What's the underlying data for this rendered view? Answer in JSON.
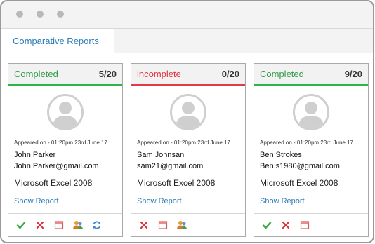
{
  "window": {
    "tab_label": "Comparative Reports"
  },
  "cards": [
    {
      "status": "Completed",
      "count": "5/20",
      "appeared": "Appeared on - 01:20pm 23rd June 17",
      "name": "John Parker",
      "email": "John.Parker@gmail.com",
      "course": "Microsoft Excel 2008",
      "link": "Show Report",
      "actions": [
        "check-icon",
        "cross-icon",
        "window-icon",
        "users-icon",
        "refresh-icon"
      ]
    },
    {
      "status": "incomplete",
      "count": "0/20",
      "appeared": "Appeared on - 01:20pm 23rd June 17",
      "name": "Sam Johnsan",
      "email": "sam21@gmail.com",
      "course": "Microsoft Excel 2008",
      "link": "Show Report",
      "actions": [
        "cross-icon",
        "window-icon",
        "users-icon"
      ]
    },
    {
      "status": "Completed",
      "count": "9/20",
      "appeared": "Appeared on - 01:20pm 23rd June 17",
      "name": "Ben Strokes",
      "email": "Ben.s1980@gmail.com",
      "course": "Microsoft Excel 2008",
      "link": "Show Report",
      "actions": [
        "check-icon",
        "cross-icon",
        "window-icon"
      ]
    }
  ],
  "colors": {
    "complete": "#2f9a45",
    "incomplete": "#e0323e",
    "link": "#2a7bb6"
  }
}
